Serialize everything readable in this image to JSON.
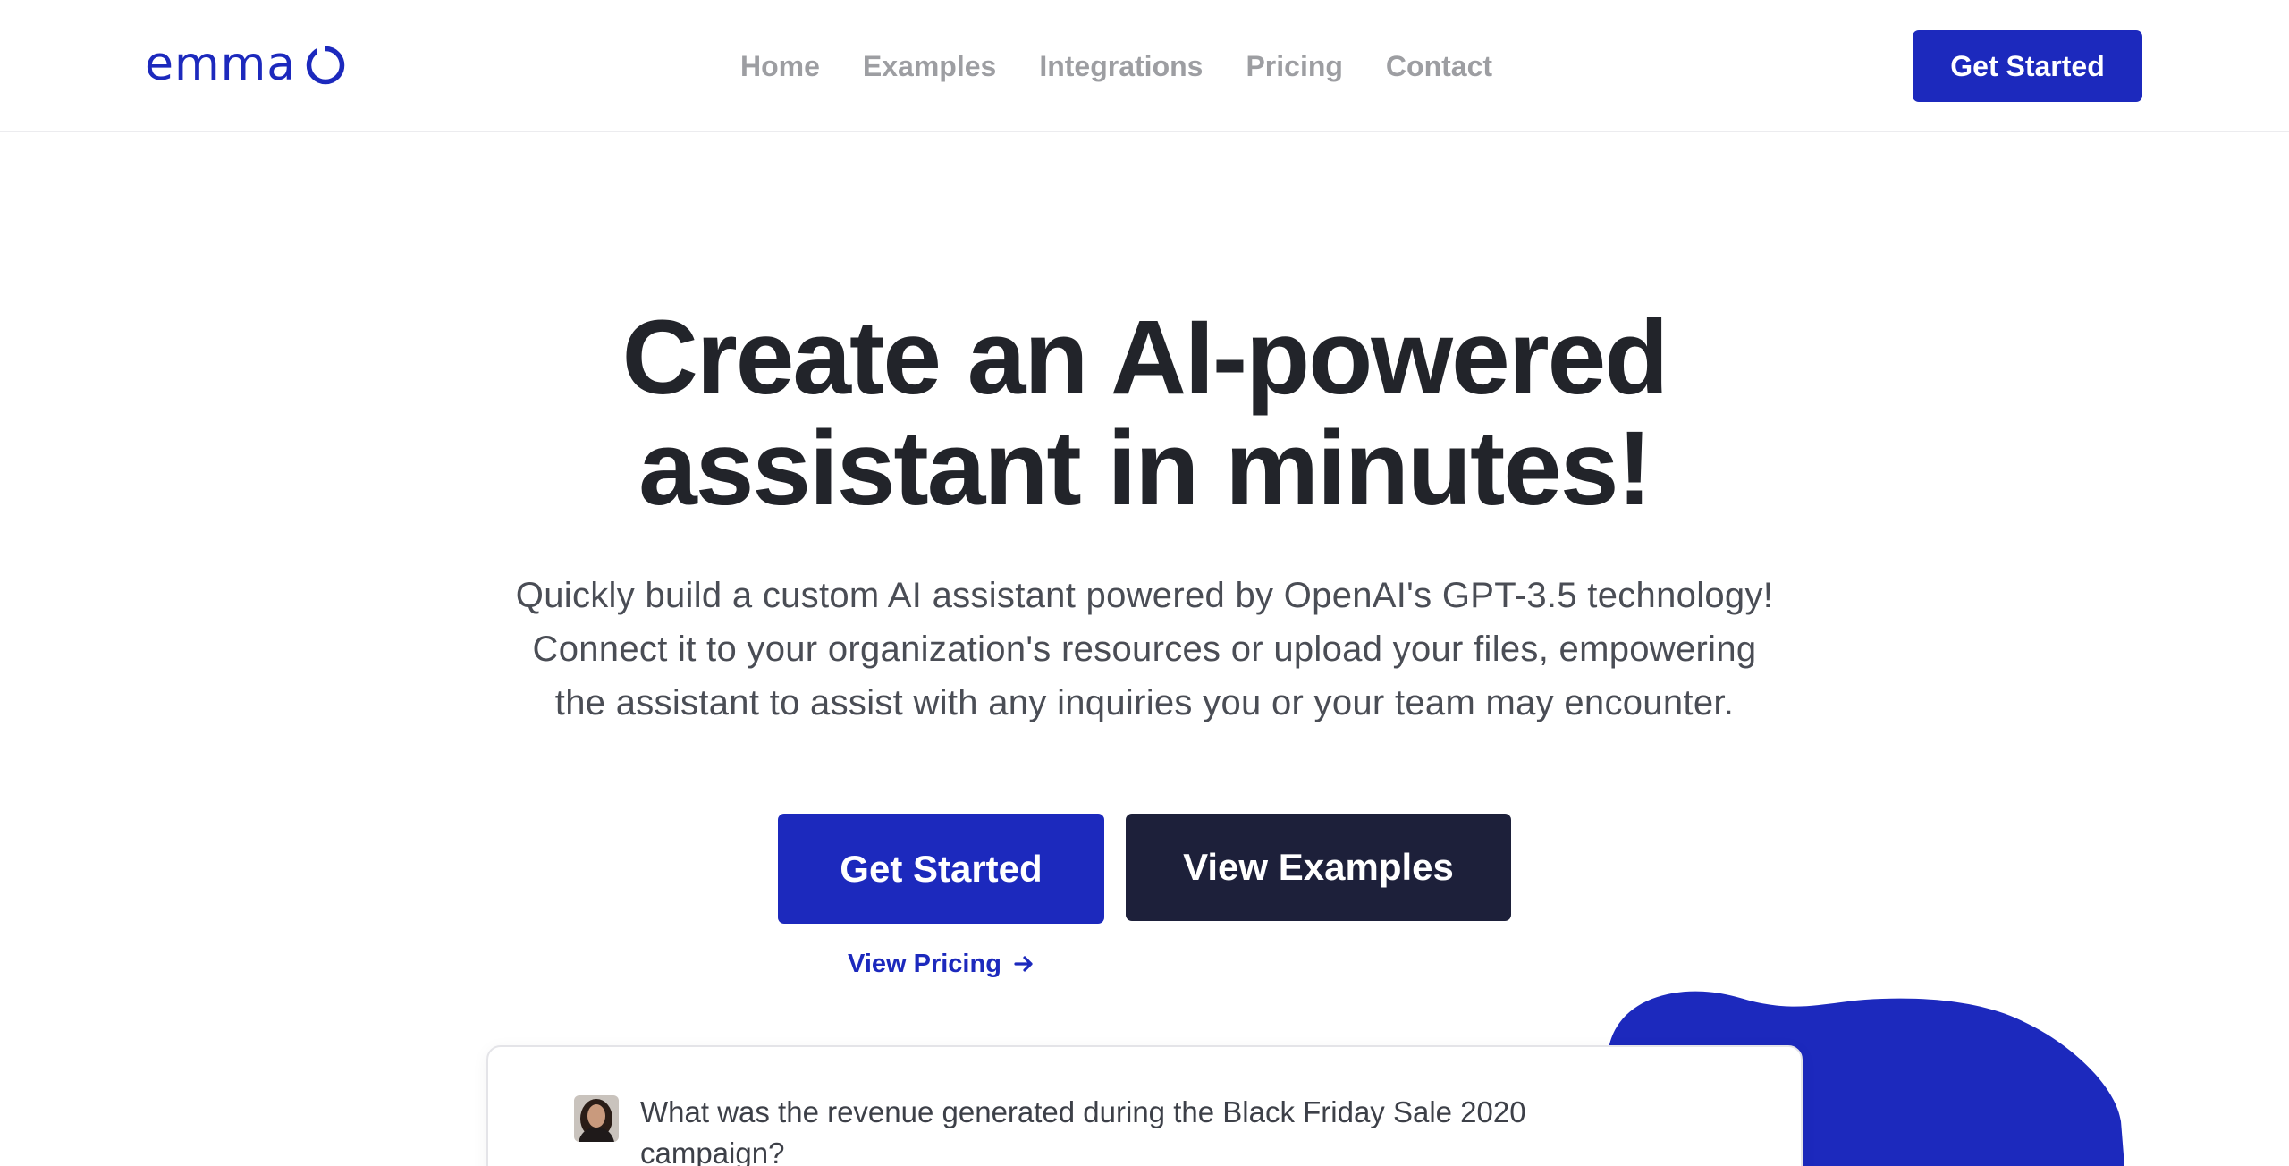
{
  "header": {
    "logo_text": "emma",
    "logo_icon": "ring-icon",
    "nav": [
      "Home",
      "Examples",
      "Integrations",
      "Pricing",
      "Contact"
    ],
    "cta_label": "Get Started"
  },
  "hero": {
    "title_line1": "Create an AI-powered",
    "title_line2": "assistant in minutes!",
    "subtitle_line1": "Quickly build a custom AI assistant powered by OpenAI's GPT-3.5 technology!",
    "subtitle_line2": "Connect it to your organization's resources or upload your files, empowering",
    "subtitle_line3": "the assistant to assist with any inquiries you or your team may encounter.",
    "primary_button": "Get Started",
    "secondary_button": "View Examples",
    "pricing_link": "View Pricing",
    "pricing_link_icon": "arrow-right-icon"
  },
  "chat": {
    "message": "What was the revenue generated during the Black Friday Sale 2020 campaign?"
  },
  "colors": {
    "brand_blue": "#1c29bd",
    "dark_button": "#1d203a",
    "nav_gray": "#9d9ea2",
    "heading": "#22242a"
  }
}
